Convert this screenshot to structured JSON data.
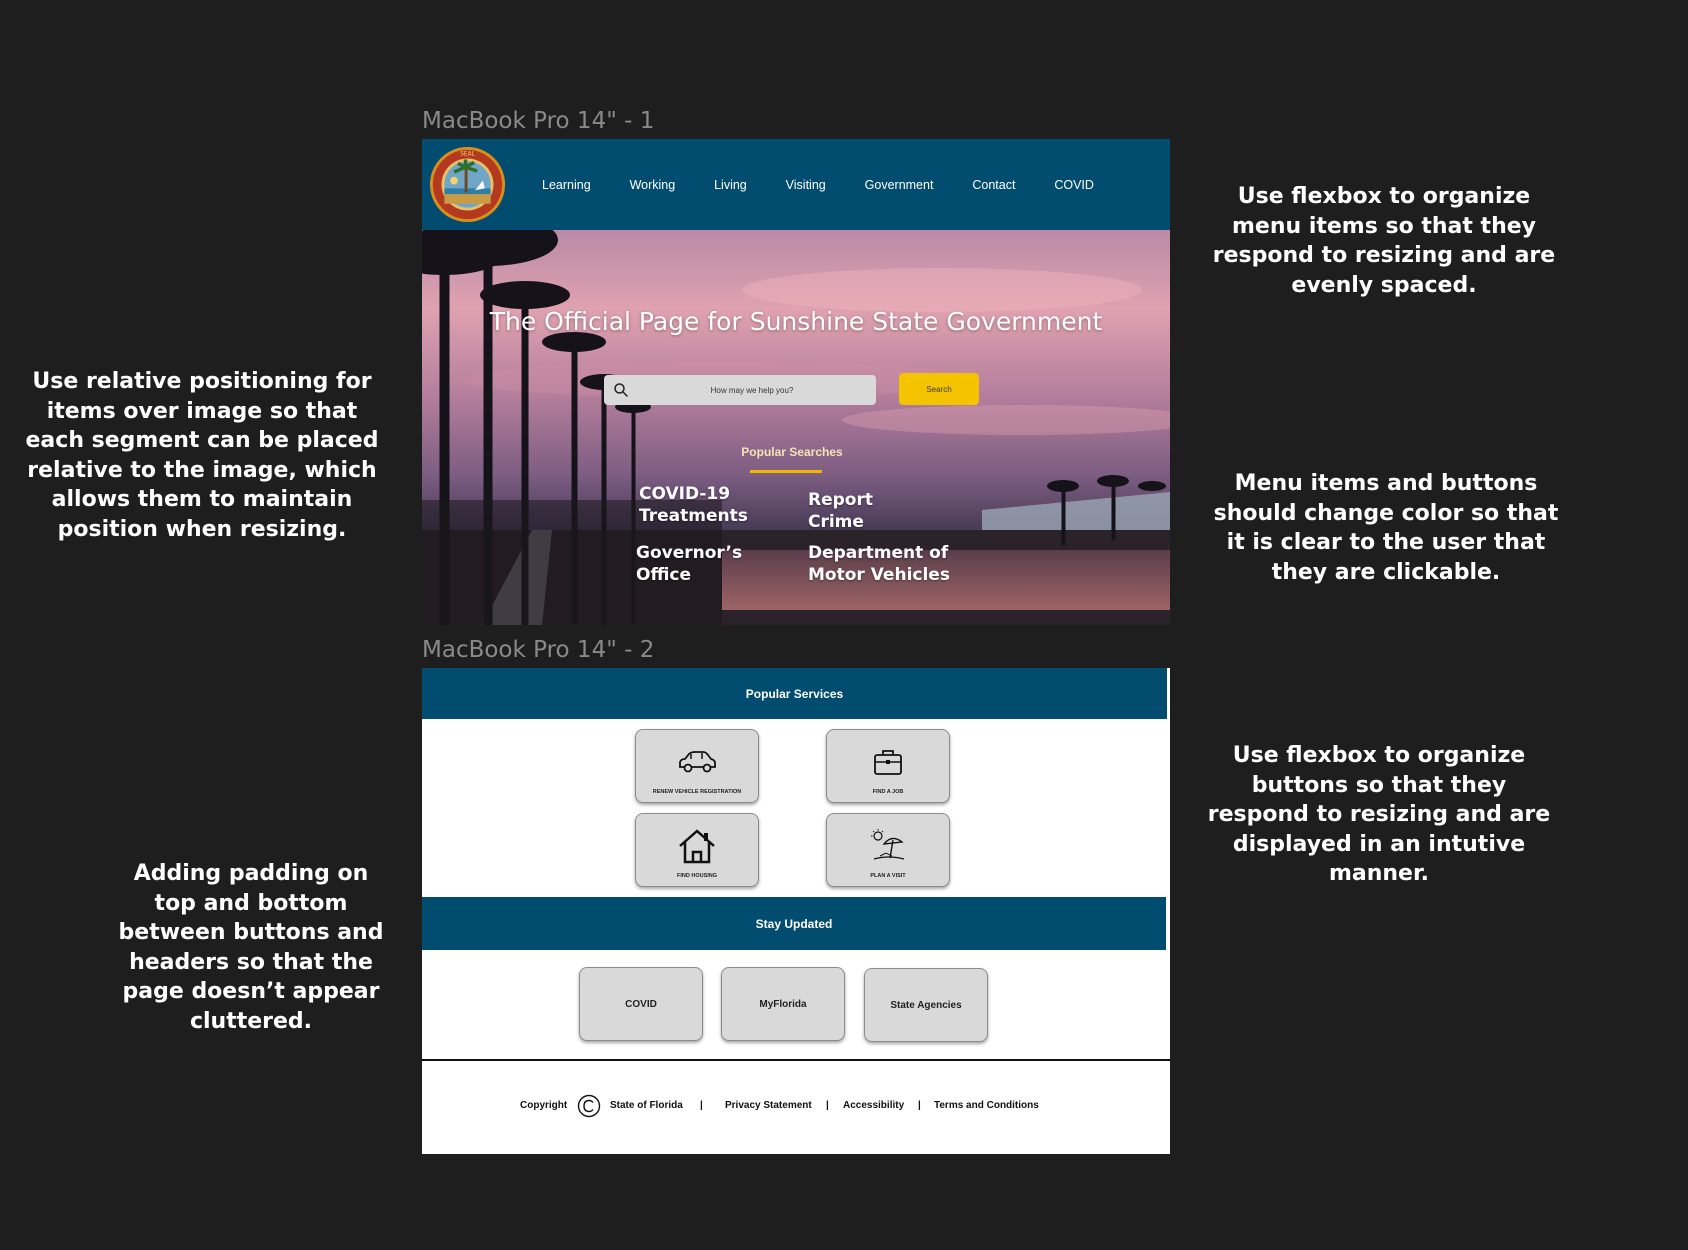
{
  "frames": {
    "frame1_label": "MacBook Pro 14\" - 1",
    "frame2_label": "MacBook Pro 14\" - 2"
  },
  "notes": {
    "left_top": "Use relative positioning for items over image so that each segment can be placed relative to the image, which allows them to maintain position when resizing.",
    "left_bottom": "Adding padding on top and bottom between buttons and headers so that the page doesn’t appear cluttered.",
    "right_top": "Use flexbox to organize menu items so that they respond to resizing and are evenly spaced.",
    "right_middle": "Menu items and buttons should change color so that it is clear to the user that they are clickable.",
    "right_bottom": "Use flexbox to organize buttons so that they respond to resizing and are displayed in an intutive manner."
  },
  "nav": {
    "items": [
      "Learning",
      "Working",
      "Living",
      "Visiting",
      "Government",
      "Contact",
      "COVID"
    ]
  },
  "hero": {
    "title": "The Official Page for Sunshine State Government",
    "search_placeholder": "How may we help you?",
    "search_button": "Search",
    "popular_label": "Popular Searches",
    "links": {
      "covid": "COVID-19 Treatments",
      "report": "Report Crime",
      "governor": "Governor’s Office",
      "dmv": "Department of Motor Vehicles"
    }
  },
  "services": {
    "header": "Popular Services",
    "buttons": [
      {
        "label": "Renew Vehicle Registration",
        "icon": "car-icon"
      },
      {
        "label": "Find a Job",
        "icon": "briefcase-icon"
      },
      {
        "label": "Find Housing",
        "icon": "house-icon"
      },
      {
        "label": "Plan a Visit",
        "icon": "beach-umbrella-icon"
      }
    ]
  },
  "updates": {
    "header": "Stay Updated",
    "buttons": [
      "COVID",
      "MyFlorida",
      "State Agencies"
    ]
  },
  "footer": {
    "copyright": "Copyright",
    "owner": "State of Florida",
    "separator": "|",
    "links": [
      "Privacy Statement",
      "Accessibility",
      "Terms and Conditions"
    ]
  },
  "colors": {
    "background": "#1e1e1e",
    "nav_blue": "#024c70",
    "accent_yellow": "#f4c400",
    "button_gray": "#d9d9d9"
  }
}
